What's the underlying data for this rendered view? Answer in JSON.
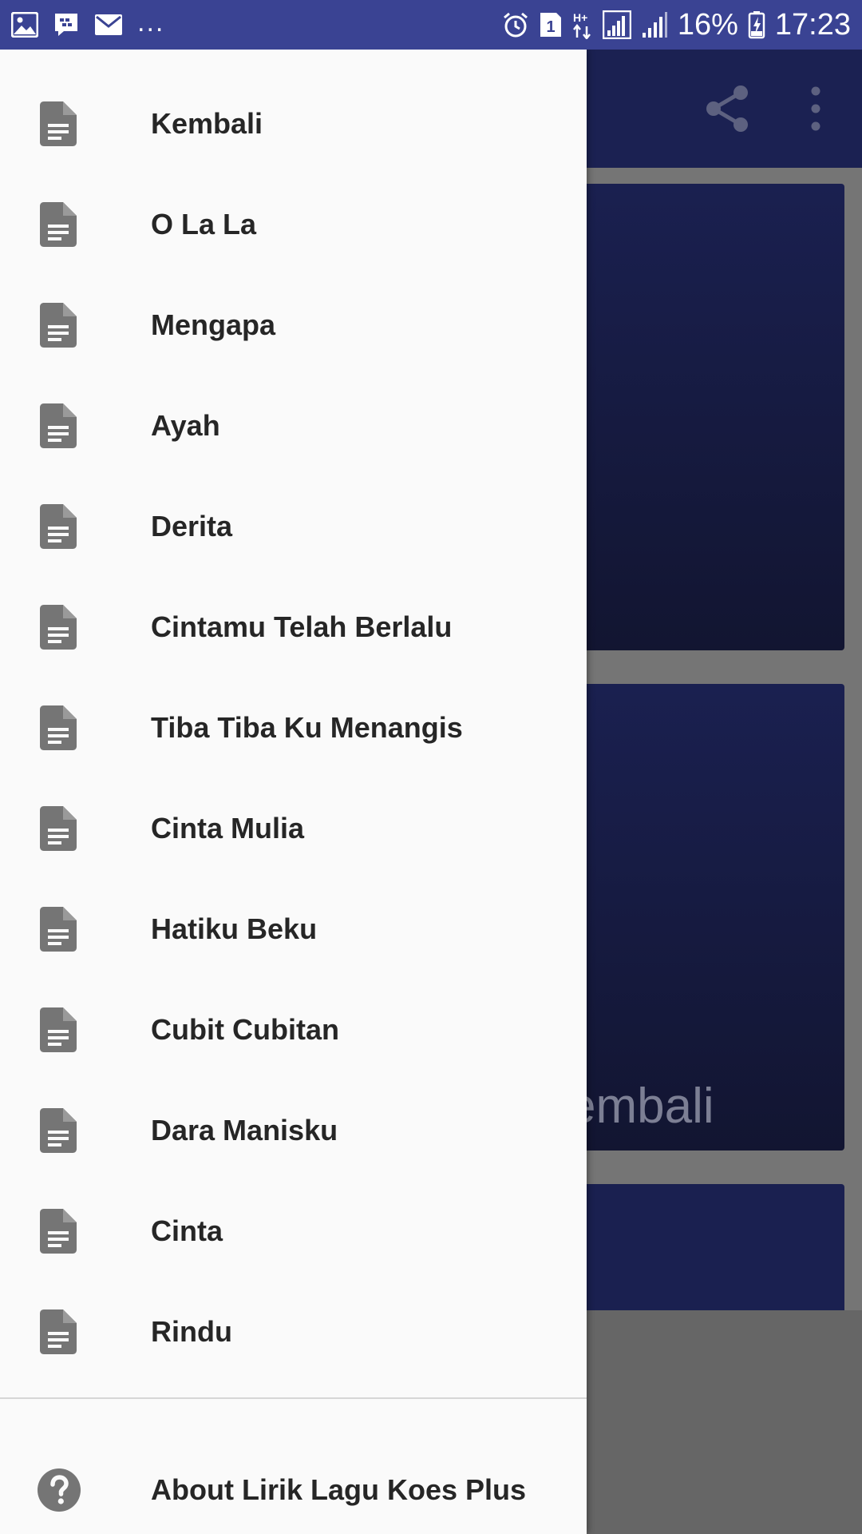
{
  "status_bar": {
    "battery_percent": "16%",
    "time": "17:23",
    "notification_overflow": "...",
    "icons_left": [
      "image-icon",
      "bbm-icon",
      "mail-icon"
    ],
    "icons_right": [
      "alarm-icon",
      "sim-1-icon",
      "hplus-data-icon",
      "signal-icon",
      "signal-2-icon",
      "battery-charging-icon"
    ]
  },
  "app": {
    "toolbar_actions": [
      "share-icon",
      "more-vert-icon"
    ],
    "card_2_title_visible": "embali"
  },
  "drawer": {
    "items": [
      {
        "label": "Kembali",
        "icon": "document-icon"
      },
      {
        "label": "O La La",
        "icon": "document-icon"
      },
      {
        "label": "Mengapa",
        "icon": "document-icon"
      },
      {
        "label": "Ayah",
        "icon": "document-icon"
      },
      {
        "label": "Derita",
        "icon": "document-icon"
      },
      {
        "label": "Cintamu Telah Berlalu",
        "icon": "document-icon"
      },
      {
        "label": "Tiba Tiba Ku Menangis",
        "icon": "document-icon"
      },
      {
        "label": "Cinta Mulia",
        "icon": "document-icon"
      },
      {
        "label": "Hatiku Beku",
        "icon": "document-icon"
      },
      {
        "label": "Cubit Cubitan",
        "icon": "document-icon"
      },
      {
        "label": "Dara Manisku",
        "icon": "document-icon"
      },
      {
        "label": "Cinta",
        "icon": "document-icon"
      },
      {
        "label": "Rindu",
        "icon": "document-icon"
      }
    ],
    "about": {
      "label": "About Lirik Lagu Koes Plus",
      "icon": "help-circle-icon"
    }
  },
  "colors": {
    "status_bar": "#3a4393",
    "toolbar": "#1b2152",
    "drawer_bg": "#fafafa",
    "icon_gray": "#757575",
    "label_text": "#262626"
  }
}
